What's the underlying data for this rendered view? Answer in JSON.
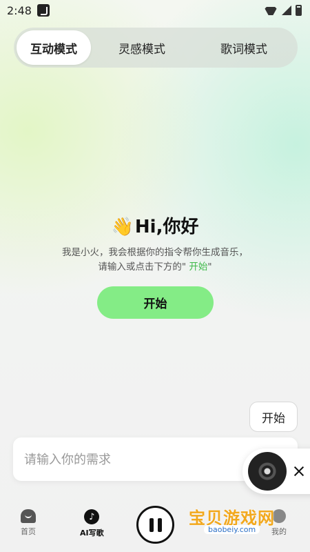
{
  "status_bar": {
    "time": "2:48"
  },
  "mode_tabs": [
    {
      "label": "互动模式",
      "active": true
    },
    {
      "label": "灵感模式",
      "active": false
    },
    {
      "label": "歌词模式",
      "active": false
    }
  ],
  "hero": {
    "greeting": "Hi,你好",
    "desc_line1": "我是小火，我会根据你的指令帮你生成音乐，",
    "desc_line2_prefix": "请输入或点击下方的\"",
    "desc_line2_highlight": " 开始",
    "desc_line2_suffix": "\"",
    "start_button": "开始"
  },
  "chip": {
    "label": "开始"
  },
  "input": {
    "placeholder": "请输入你的需求"
  },
  "bottom_nav": {
    "home": "首页",
    "ai_write": "AI写歌",
    "mine": "我的"
  },
  "watermark": {
    "title": "宝贝游戏网",
    "url": "baobeiy.com"
  },
  "colors": {
    "accent": "#84ec86",
    "highlight": "#3fb94a"
  }
}
